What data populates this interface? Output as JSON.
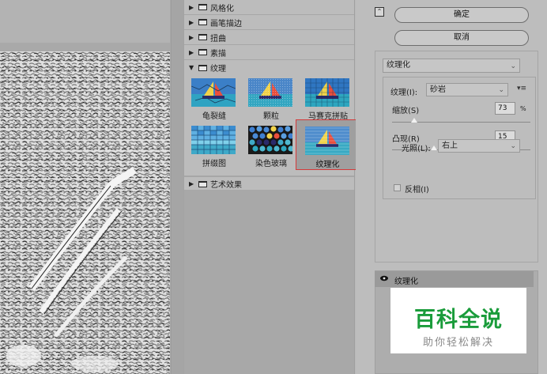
{
  "gallery": {
    "categories_top": [
      {
        "label": "风格化",
        "expanded": false
      },
      {
        "label": "画笔描边",
        "expanded": false
      },
      {
        "label": "扭曲",
        "expanded": false
      },
      {
        "label": "素描",
        "expanded": false
      }
    ],
    "open_category": {
      "label": "纹理",
      "expanded": true
    },
    "thumbnails": [
      {
        "caption": "龟裂缝",
        "selected": false
      },
      {
        "caption": "颗粒",
        "selected": false
      },
      {
        "caption": "马赛克拼贴",
        "selected": false
      },
      {
        "caption": "拼缀图",
        "selected": false
      },
      {
        "caption": "染色玻璃",
        "selected": false
      },
      {
        "caption": "纹理化",
        "selected": true
      }
    ],
    "categories_bottom": [
      {
        "label": "艺术效果",
        "expanded": false
      }
    ]
  },
  "settings": {
    "collapse_icon": "collapse-up-icon",
    "ok_label": "确定",
    "cancel_label": "取消",
    "filter_select": "纹理化",
    "texture_label": "纹理(I):",
    "texture_value": "砂岩",
    "scaling_label": "缩放(S)",
    "scaling_value": "73",
    "scaling_unit": "%",
    "scaling_fraction": 0.16,
    "relief_label": "凸现(R)",
    "relief_value": "15",
    "relief_fraction": 0.3,
    "light_label": "光照(L):",
    "light_value": "右上",
    "invert_label": "反相(I)",
    "invert_checked": false
  },
  "layers": {
    "effect_name": "纹理化",
    "visibility_icon": "eye-icon"
  },
  "watermark": {
    "title": "百科全说",
    "subtitle": "助你轻松解决"
  },
  "colors": {
    "selection_border": "#d43a3a",
    "watermark_green": "#1a9c3b"
  }
}
